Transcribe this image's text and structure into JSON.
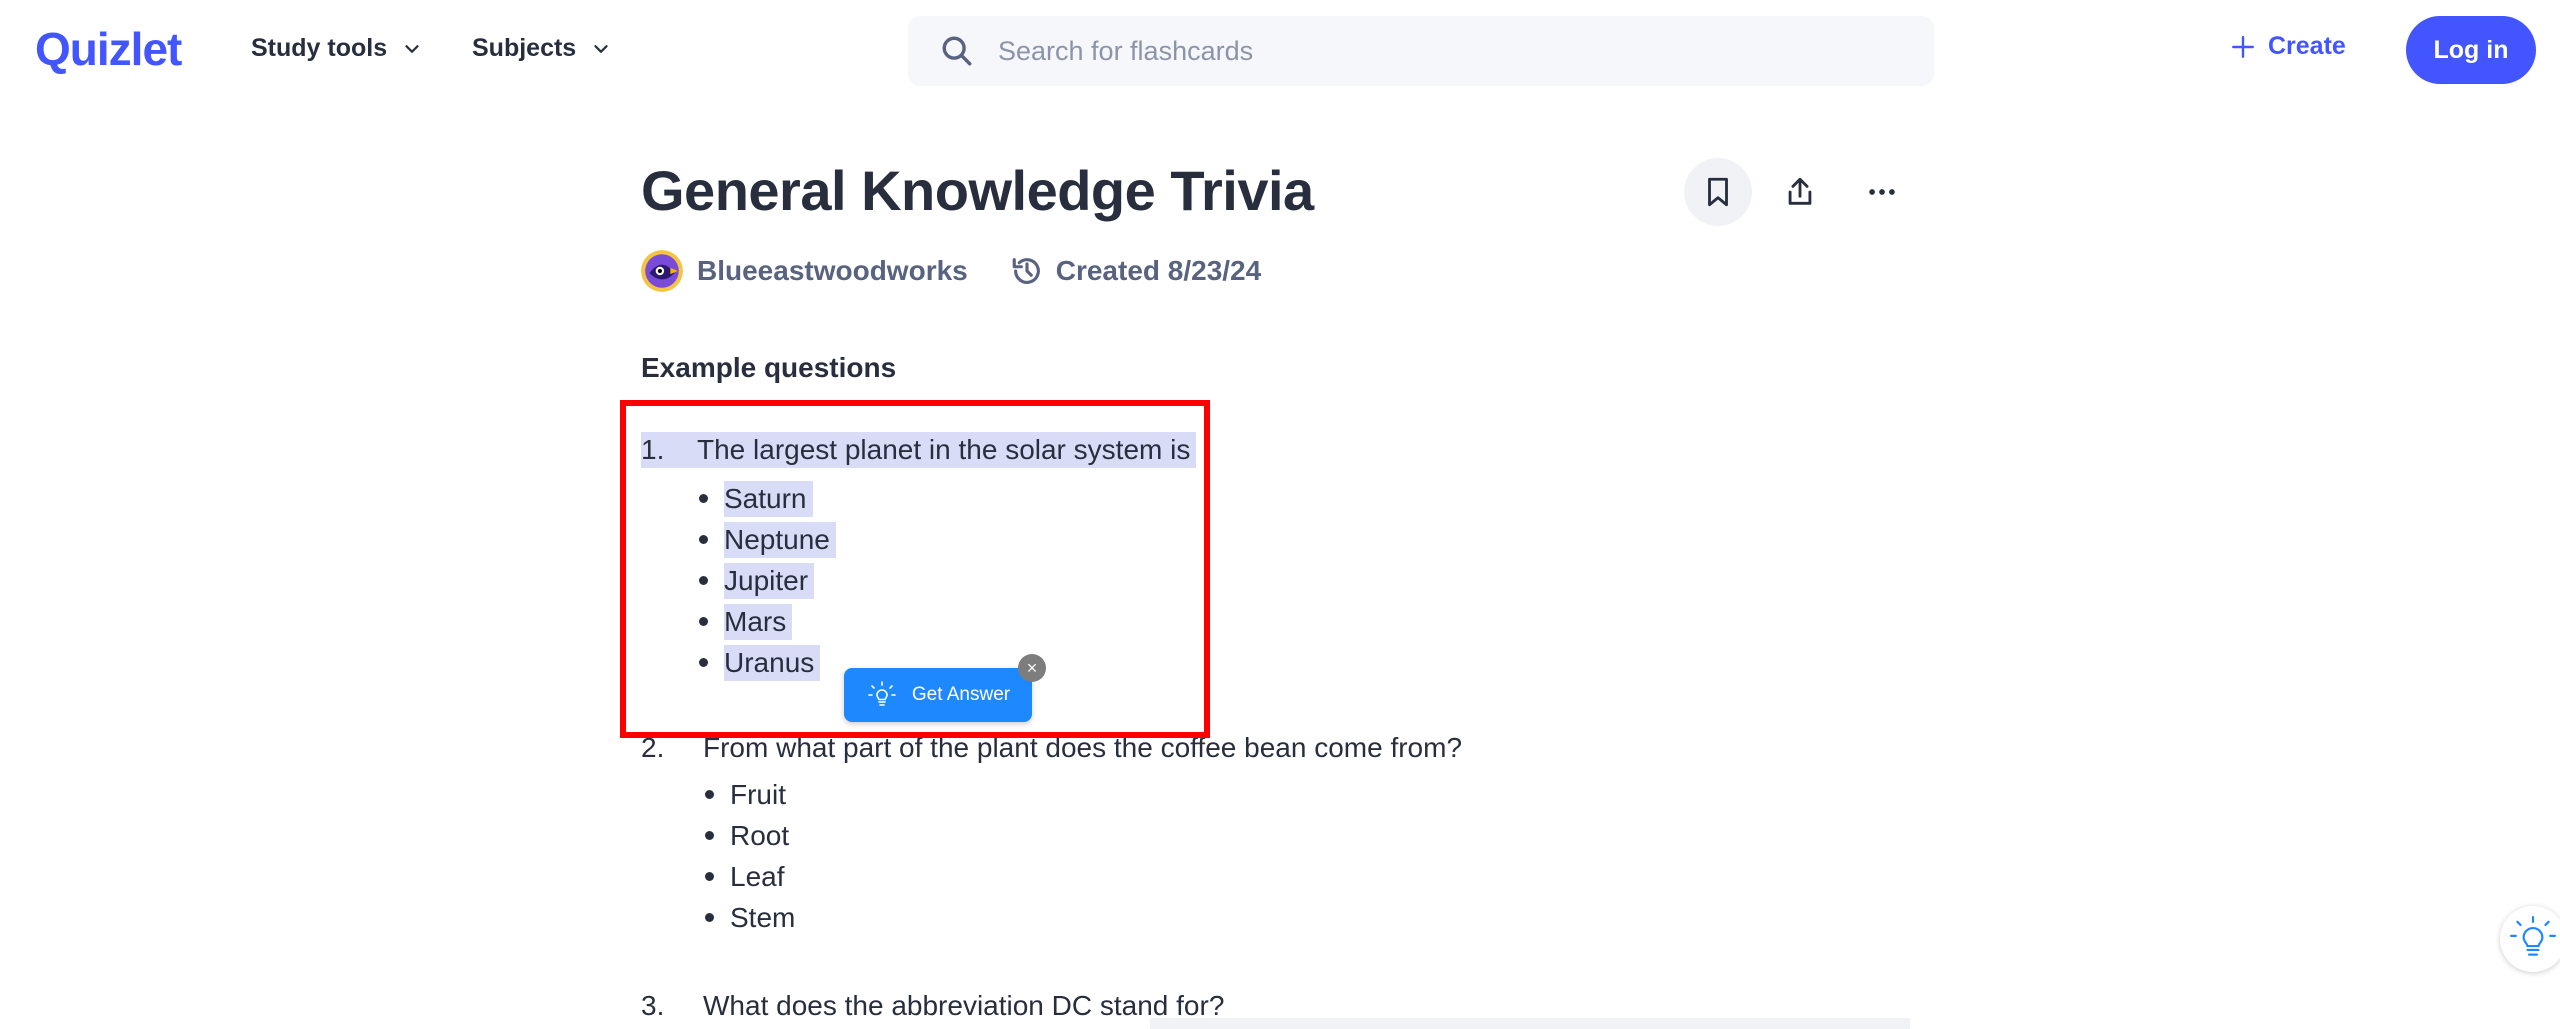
{
  "header": {
    "logo": "Quizlet",
    "nav": [
      {
        "label": "Study tools"
      },
      {
        "label": "Subjects"
      }
    ],
    "search": {
      "placeholder": "Search for flashcards",
      "value": ""
    },
    "create_label": "Create",
    "login_label": "Log in"
  },
  "set": {
    "title": "General Knowledge Trivia",
    "author": "Blueeastwoodworks",
    "created": "Created 8/23/24"
  },
  "section_title": "Example questions",
  "questions": [
    {
      "number": "1.",
      "text": "The largest planet in the solar system is",
      "options": [
        "Saturn",
        "Neptune",
        "Jupiter",
        "Mars",
        "Uranus"
      ]
    },
    {
      "number": "2.",
      "text": "From what part of the plant does the coffee bean come from?",
      "options": [
        "Fruit",
        "Root",
        "Leaf",
        "Stem"
      ]
    },
    {
      "number": "3.",
      "text": "What does the abbreviation DC stand for?",
      "options": []
    }
  ],
  "popup": {
    "label": "Get Answer",
    "close_symbol": "×"
  },
  "colors": {
    "brand": "#4255ff",
    "highlight": "#d9dcf7",
    "annotation": "#ff0000",
    "popup": "#1e88ff"
  },
  "icons": [
    "search-icon",
    "chevron-down-icon",
    "plus-icon",
    "bookmark-icon",
    "share-icon",
    "more-icon",
    "history-icon",
    "lightbulb-icon",
    "close-icon"
  ]
}
